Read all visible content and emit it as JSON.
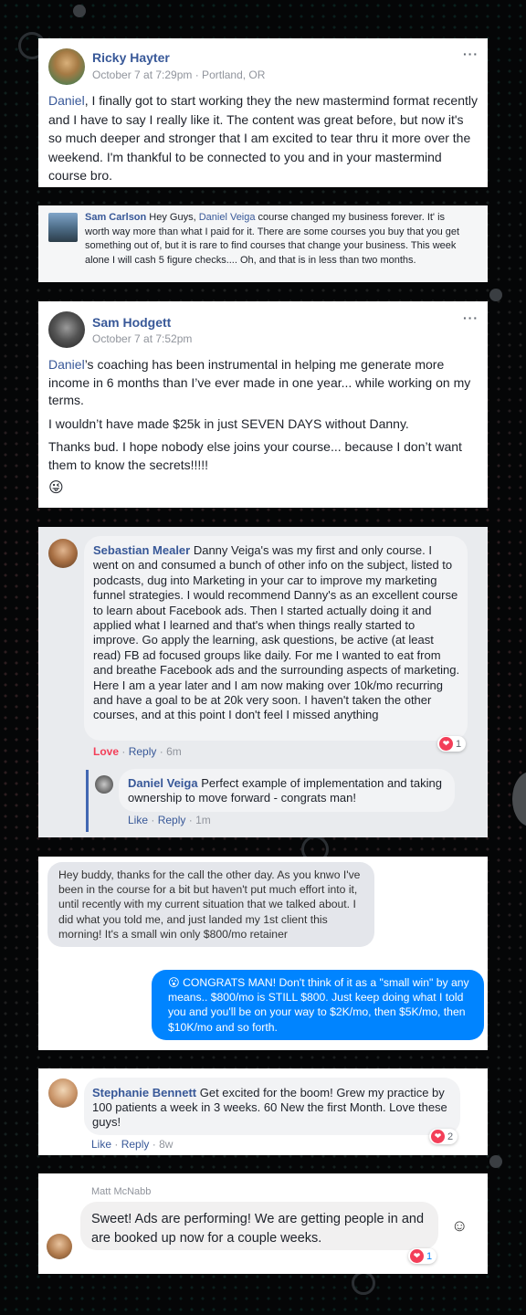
{
  "posts": [
    {
      "author": "Ricky Hayter",
      "meta": "October 7 at 7:29pm · Portland, OR",
      "mention": "Daniel",
      "body": ", I finally got to start working they the new mastermind format recently and I have to say I really like it. The content was great before, but now it's so much deeper and stronger that I am excited to tear thru it more over the weekend. I'm thankful to be connected to you and in your mastermind course bro.",
      "more": "···"
    },
    {
      "author": "Sam Carlson",
      "lead": " Hey Guys, ",
      "mention": "Daniel Veiga",
      "body": " course changed my business forever. It' is worth way more than what I paid for it. There are some courses you buy that you get something out of, but it is rare to find courses that change your business. This week alone I will cash 5 figure checks.... Oh, and that is in less than two months."
    },
    {
      "author": "Sam Hodgett",
      "meta": "October 7 at 7:52pm",
      "mention": "Daniel",
      "p1": "’s coaching has been instrumental in helping me generate more income in 6 months than I’ve ever made in one year... while working on my terms.",
      "p2": "I wouldn’t have made $25k in just SEVEN DAYS without Danny.",
      "p3": "Thanks bud. I hope nobody else joins your course... because I don’t want them to know the secrets!!!!!",
      "emoji": "😜",
      "more": "···"
    },
    {
      "author": "Sebastian Mealer",
      "body": " Danny Veiga's was my first and only course. I went on and consumed a bunch of other info on the subject, listed to podcasts, dug into Marketing in your car to improve my marketing funnel strategies. I would recommend Danny's as an excellent course to learn about Facebook ads. Then I started actually doing it and applied what I learned and that's when things really started to improve. Go apply the learning, ask questions, be active (at least read) FB ad focused groups like daily. For me I wanted to eat from and breathe Facebook ads and the surrounding aspects of marketing. Here I am a year later and I am now making over 10k/mo recurring and have a goal to be at 20k very soon. I haven't taken the other courses, and at this point I don't feel I missed anything",
      "love": "Love",
      "reply": "Reply",
      "time": "6m",
      "reactions": "1",
      "reply_author": "Daniel Veiga",
      "reply_body": " Perfect example of implementation and taking ownership to move forward - congrats man!",
      "reply_like": "Like",
      "reply_reply": "Reply",
      "reply_time": "1m"
    },
    {
      "incoming": "Hey buddy, thanks for the call the other day. As you knwo I've been in the course for a bit but haven't put much effort into it, until recently with my current situation that we talked about. I did what you told me, and just landed my 1st client this morning! It's a small win only $800/mo retainer",
      "outgoing_emoji": "😮",
      "outgoing": " CONGRATS MAN! Don't think of it as a \"small win\" by any means.. $800/mo is STILL $800. Just keep doing what I told you and you'll be on your way to $2K/mo, then $5K/mo, then $10K/mo and so forth."
    },
    {
      "author": "Stephanie Bennett",
      "body": " Get excited for the boom! Grew my practice by 100 patients a week in 3 weeks. 60 New the first Month. Love these guys!",
      "like": "Like",
      "reply": "Reply",
      "time": "8w",
      "reactions": "2"
    },
    {
      "author": "Matt McNabb",
      "body": "Sweet! Ads are performing! We are getting people in and are booked up now for a couple weeks.",
      "reactions": "1",
      "smiley": "☺"
    }
  ],
  "colors": {
    "link": "#385898",
    "messenger_blue": "#0084ff",
    "heart": "#f33e58",
    "bubble_gray": "#f2f3f5"
  }
}
